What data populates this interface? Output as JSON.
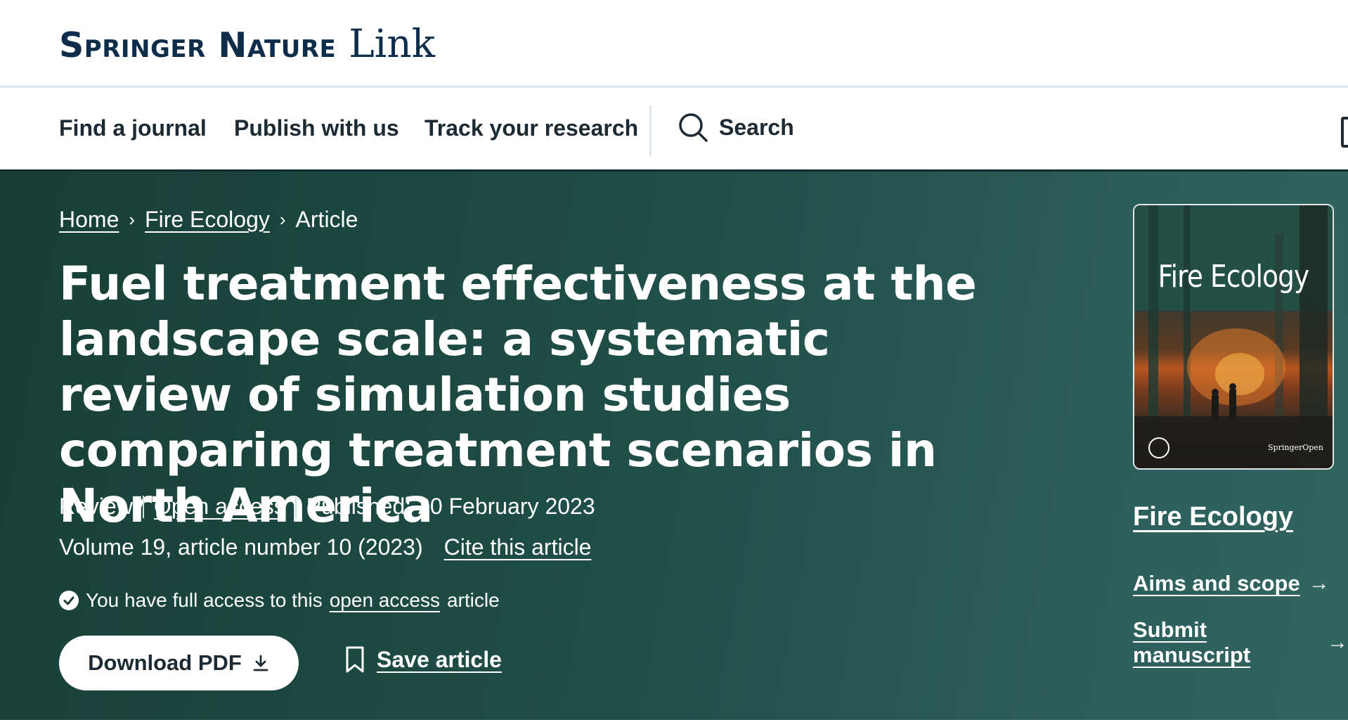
{
  "logo": {
    "brand": "Springer Nature",
    "product": "Link"
  },
  "nav": {
    "items": [
      "Find a journal",
      "Publish with us",
      "Track your research"
    ],
    "search_label": "Search"
  },
  "breadcrumb": {
    "home": "Home",
    "journal": "Fire Ecology",
    "current": "Article"
  },
  "article": {
    "title": "Fuel treatment effectiveness at the landscape scale: a systematic review of simulation studies comparing treatment scenarios in North America",
    "type": "Review",
    "open_access": "Open access",
    "published": "Published: 20 February 2023",
    "volume": "Volume 19, article number 10 (2023)",
    "cite": "Cite this article",
    "access_prefix": "You have full access to this",
    "access_link": "open access",
    "access_suffix": "article"
  },
  "actions": {
    "download": "Download PDF",
    "save": "Save article"
  },
  "journal_panel": {
    "cover_title": "Fire Ecology",
    "cover_publisher": "SpringerOpen",
    "journal_name": "Fire Ecology",
    "aims": "Aims and scope",
    "submit": "Submit manuscript"
  },
  "colors": {
    "hero_start": "#173f37",
    "hero_end": "#31655f",
    "brand_navy": "#0d2d4a"
  }
}
